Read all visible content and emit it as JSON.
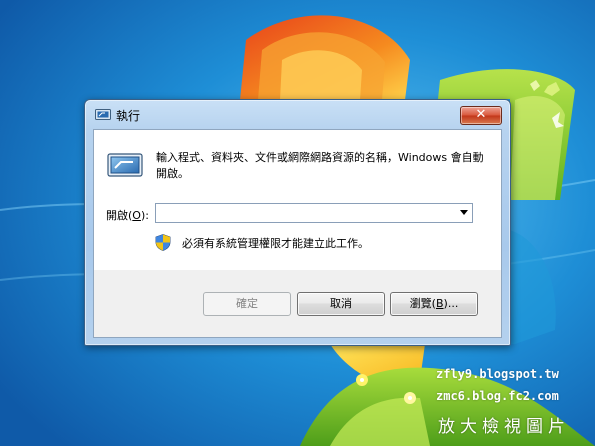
{
  "window": {
    "title": "執行",
    "close_label": "✕",
    "description": "輸入程式、資料夾、文件或網際網路資源的名稱，Windows 會自動開啟。",
    "open_label_prefix": "開啟(",
    "open_label_key": "O",
    "open_label_suffix": "):",
    "open_value": "",
    "admin_note": "必須有系統管理權限才能建立此工作。"
  },
  "buttons": {
    "ok": "確定",
    "cancel": "取消",
    "browse_prefix": "瀏覽(",
    "browse_key": "B",
    "browse_suffix": ")..."
  },
  "watermark": {
    "line1": "zfly9.blogspot.tw",
    "line2": "zmc6.blog.fc2.com",
    "line3": "放大檢視圖片"
  },
  "colors": {
    "desktop_blue": "#1f7fcf",
    "window_frame": "#b7d3ef",
    "close_red": "#c2361a"
  },
  "icons": [
    "run-program-icon",
    "shield-icon",
    "close-icon",
    "dropdown-arrow-icon",
    "flag-icon"
  ]
}
